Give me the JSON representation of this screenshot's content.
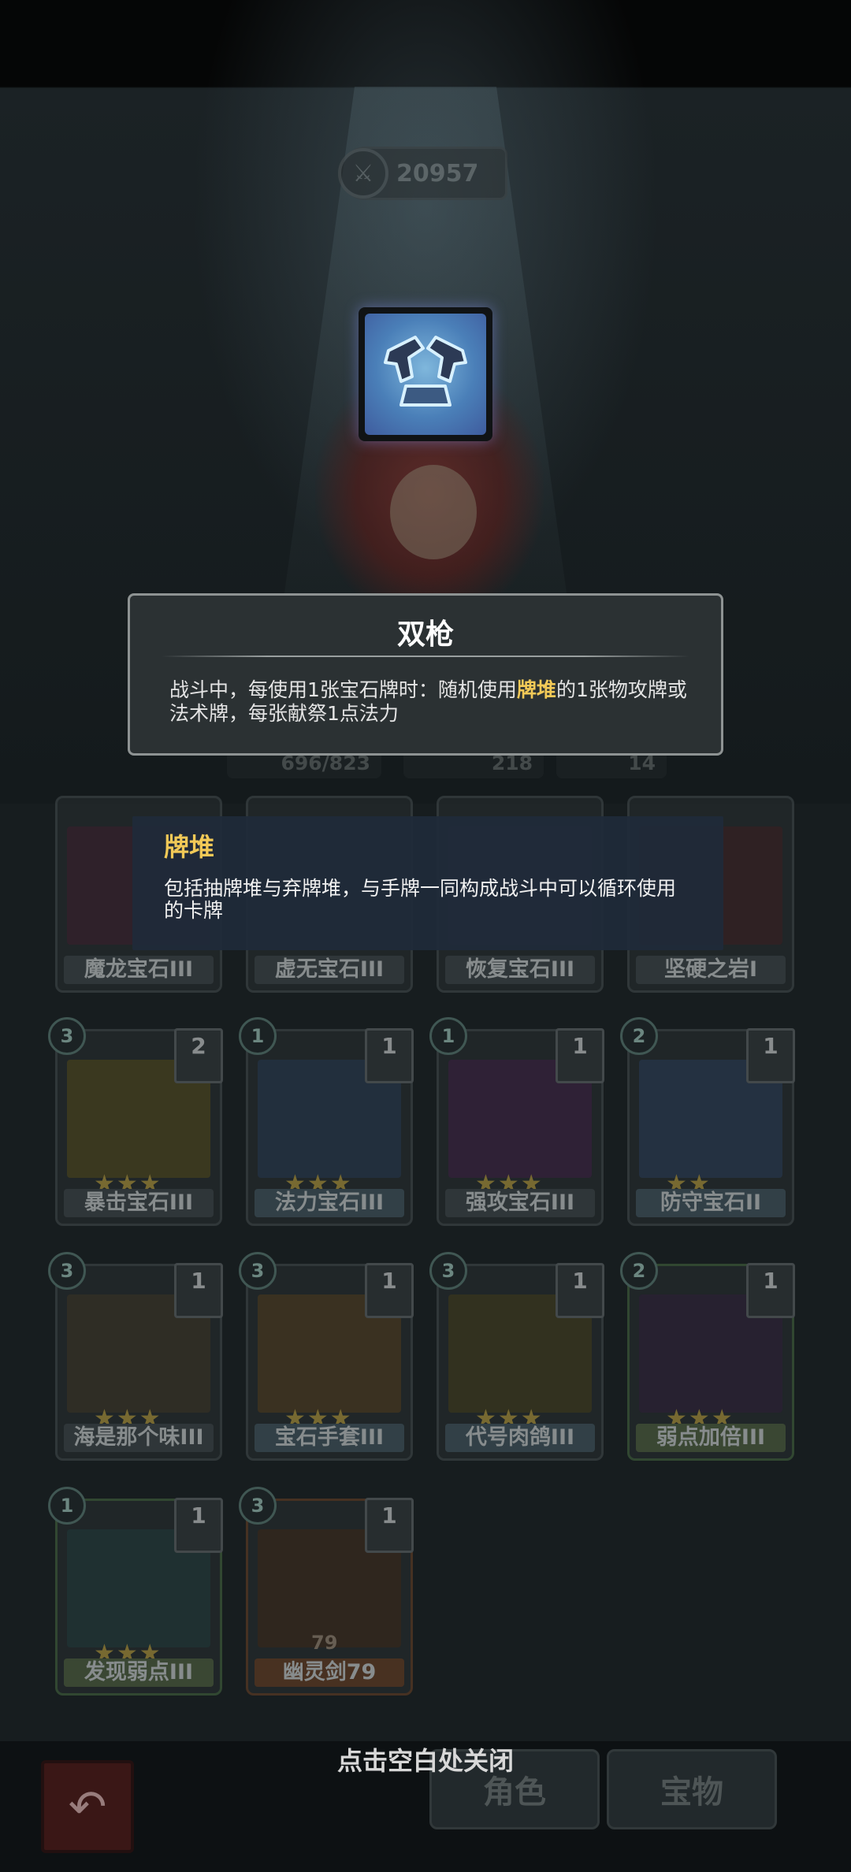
{
  "score": {
    "value": "20957",
    "icon": "sword-coin-icon"
  },
  "relic": {
    "icon": "crossed-pistols-icon",
    "title": "双枪",
    "desc_prefix": "战斗中，每使用1张宝石牌时：随机使用",
    "desc_highlight": "牌堆",
    "desc_suffix": "的1张物攻牌或法术牌，每张献祭1点法力"
  },
  "stats": {
    "hp": "696/823",
    "attack": "218",
    "mana": "14"
  },
  "deck_tip": {
    "title": "牌堆",
    "desc": "包括抽牌堆与弃牌堆，与手牌一同构成战斗中可以循环使用的卡牌"
  },
  "cards_row0": [
    {
      "name": "魔龙宝石III"
    },
    {
      "name": "虚无宝石III"
    },
    {
      "name": "恢复宝石III"
    },
    {
      "name": "坚硬之岩I"
    }
  ],
  "cards": [
    {
      "name": "暴击宝石III",
      "cost": "3",
      "level": "2"
    },
    {
      "name": "法力宝石III",
      "cost": "1",
      "level": "1"
    },
    {
      "name": "强攻宝石III",
      "cost": "1",
      "level": "1"
    },
    {
      "name": "防守宝石II",
      "cost": "2",
      "level": "1"
    },
    {
      "name": "海是那个味III",
      "cost": "3",
      "level": "1"
    },
    {
      "name": "宝石手套III",
      "cost": "3",
      "level": "1"
    },
    {
      "name": "代号肉鸽III",
      "cost": "3",
      "level": "1"
    },
    {
      "name": "弱点加倍III",
      "cost": "2",
      "level": "1"
    },
    {
      "name": "发现弱点III",
      "cost": "1",
      "level": "1"
    },
    {
      "name": "幽灵剑79",
      "cost": "3",
      "level": "1",
      "badge": "79"
    }
  ],
  "bottom": {
    "close_hint": "点击空白处关闭",
    "tab_role": "角色",
    "tab_treasure": "宝物",
    "back_icon": "back-arrow-icon"
  }
}
